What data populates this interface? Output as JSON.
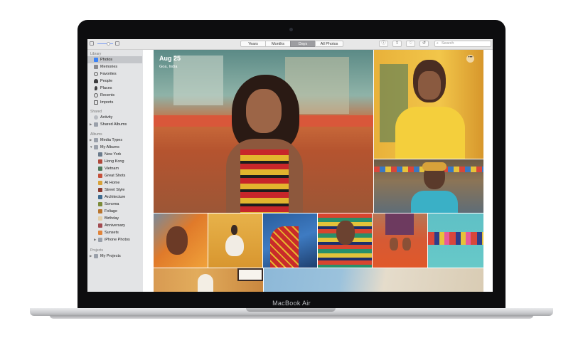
{
  "device": {
    "brand": "MacBook Air"
  },
  "toolbar": {
    "tabs": [
      {
        "label": "Years",
        "active": false
      },
      {
        "label": "Months",
        "active": false
      },
      {
        "label": "Days",
        "active": true
      },
      {
        "label": "All Photos",
        "active": false
      }
    ],
    "search_placeholder": "Search"
  },
  "sidebar": {
    "library_header": "Library",
    "library": [
      "Photos",
      "Memories",
      "Favorites",
      "People",
      "Places",
      "Recents",
      "Imports"
    ],
    "shared_header": "Shared",
    "shared": [
      "Activity",
      "Shared Albums"
    ],
    "albums_header": "Albums",
    "albums": [
      "Media Types",
      "My Albums"
    ],
    "my_albums": [
      "New York",
      "Hong Kong",
      "Vietnam",
      "Great Shots",
      "At Home",
      "Street Style",
      "Architecture",
      "Sonoma",
      "Foliage",
      "Birthday",
      "Anniversary",
      "Sunsets",
      "iPhone Photos"
    ],
    "projects_header": "Projects",
    "projects": [
      "My Projects"
    ]
  },
  "main": {
    "date": "Aug 25",
    "place": "Goa, India",
    "more_glyph": "•••"
  },
  "colors": {
    "selected_tab": "#9d9da1",
    "sidebar_bg": "#e3e4e6",
    "accent": "#1a7cf5"
  }
}
